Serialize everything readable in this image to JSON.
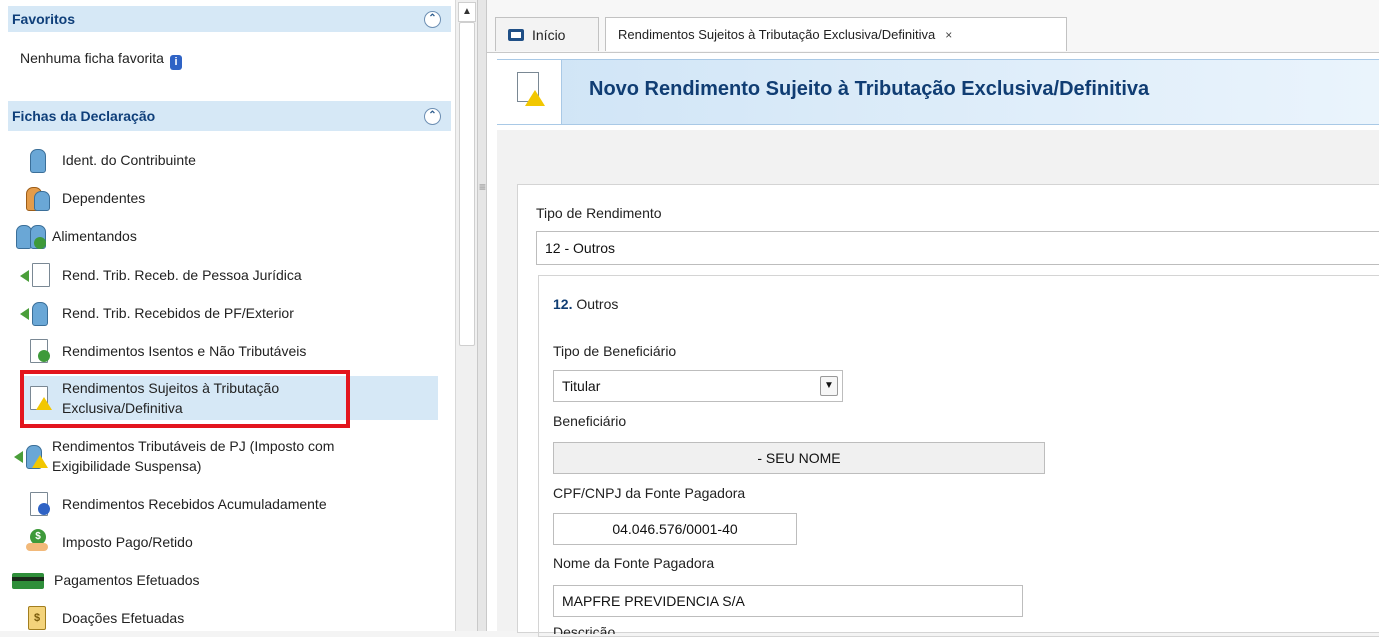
{
  "sidebar": {
    "favoritos_header": "Favoritos",
    "favoritos_empty": "Nenhuma ficha favorita",
    "fichas_header": "Fichas da Declaração",
    "items": [
      {
        "label": "Ident. do Contribuinte"
      },
      {
        "label": "Dependentes"
      },
      {
        "label": "Alimentandos"
      },
      {
        "label": "Rend. Trib. Receb. de Pessoa Jurídica"
      },
      {
        "label": "Rend. Trib. Recebidos de PF/Exterior"
      },
      {
        "label": "Rendimentos Isentos e Não Tributáveis"
      },
      {
        "label": "Rendimentos Sujeitos à Tributação Exclusiva/Definitiva"
      },
      {
        "label": "Rendimentos Tributáveis de PJ (Imposto com Exigibilidade Suspensa)"
      },
      {
        "label": "Rendimentos Recebidos Acumuladamente"
      },
      {
        "label": "Imposto Pago/Retido"
      },
      {
        "label": "Pagamentos Efetuados"
      },
      {
        "label": "Doações Efetuadas"
      }
    ]
  },
  "tabs": {
    "inicio": "Início",
    "active": "Rendimentos Sujeitos à Tributação Exclusiva/Definitiva",
    "close": "×"
  },
  "main": {
    "title": "Novo Rendimento Sujeito à Tributação Exclusiva/Definitiva",
    "tipo_rendimento_label": "Tipo de Rendimento",
    "tipo_rendimento_value": "12 - Outros",
    "section_number": "12.",
    "section_title": "Outros",
    "tipo_beneficiario_label": "Tipo de Beneficiário",
    "tipo_beneficiario_value": "Titular",
    "beneficiario_label": "Beneficiário",
    "beneficiario_value": "- SEU NOME",
    "cpf_label": "CPF/CNPJ da Fonte Pagadora",
    "cpf_value": "04.046.576/0001-40",
    "nome_fonte_label": "Nome da Fonte Pagadora",
    "nome_fonte_value": "MAPFRE PREVIDENCIA S/A",
    "descricao_label": "Descrição"
  }
}
